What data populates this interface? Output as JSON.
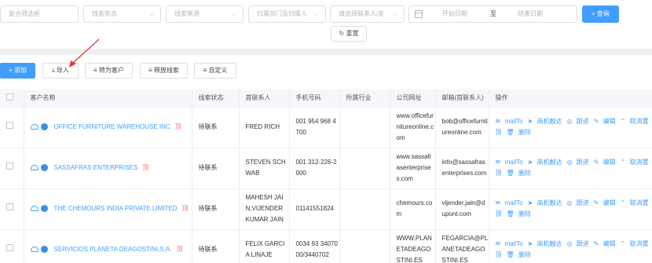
{
  "filters": {
    "composite_placeholder": "复合筛选框",
    "status_placeholder": "线索状态",
    "source_placeholder": "线索来源",
    "dept_placeholder": "归属部门及归属人",
    "contact_placeholder": "请选择联系人/友",
    "start_date_placeholder": "开始日期",
    "date_sep": "至",
    "end_date_placeholder": "结束日期",
    "query_label": "查询",
    "reset_label": "重置"
  },
  "toolbar": {
    "add_label": "添加",
    "import_label": "导入",
    "to_customer_label": "转为客户",
    "release_label": "释放线索",
    "custom_label": "自定义"
  },
  "table": {
    "headers": [
      "",
      "客户名称",
      "线索状态",
      "首联系人",
      "手机号码",
      "所属行业",
      "公司网址",
      "邮箱(首联系人)",
      "操作"
    ],
    "rows": [
      {
        "name": "OFFICE FURNITURE WAREHOUSE INC",
        "tag": "顶",
        "status": "待联系",
        "contact": "FRED RICH",
        "phone": "001 954 968 4700",
        "industry": "",
        "website": "www.officefurnitureonline.com",
        "email": "bob@officefurnitureonline.com"
      },
      {
        "name": "SASSAFRAS ENTERPRISES",
        "tag": "顶",
        "status": "待联系",
        "contact": "STEVEN SCHWAB",
        "phone": "001 312-226-2000",
        "industry": "",
        "website": "www.sassafrasenterprises.com",
        "email": "info@sassafrasenterprises.com"
      },
      {
        "name": "THE CHEMOURS INDIA PRIVATE LIMITED",
        "tag": "顶",
        "status": "待联系",
        "contact": "MAHESH JAIN,VIJENDER KUMAR JAIN",
        "phone": "01141551824",
        "industry": "",
        "website": "chemours.com",
        "email": "vijender.jain@dupont.com"
      },
      {
        "name": "SERVICIOS PLANETA DEAGOSTINI,S.A.",
        "tag": "顶",
        "status": "待联系",
        "contact": "FELIX GARCIA LINAJE",
        "phone": "0034 93 34070 00/3440702",
        "industry": "",
        "website": "WWW.PLANETADEAGOSTINI.ES",
        "email": "FEGARCIA@PLANETADEAGOSTINI.ES"
      }
    ],
    "op_mailto": "mailTo",
    "op_reach": "商机触达",
    "op_follow": "跟进",
    "op_edit": "编辑",
    "op_untop": "取消置顶",
    "op_delete": "删除"
  }
}
